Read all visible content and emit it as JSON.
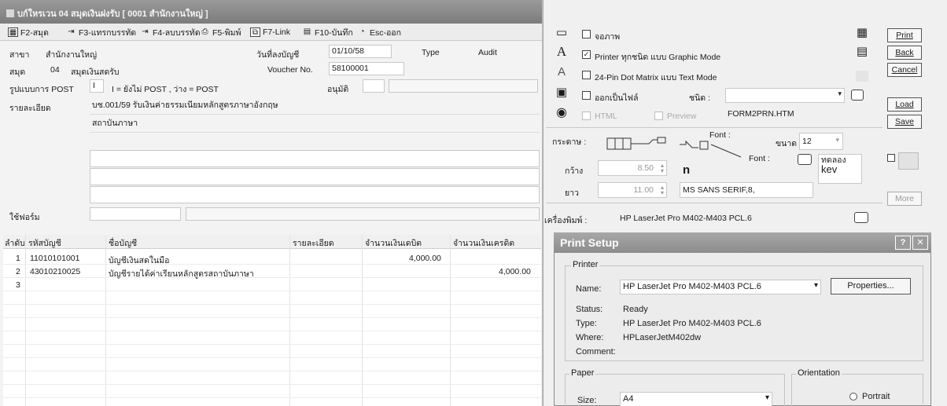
{
  "window": {
    "title": "บก์ใหรเวน 04 สมุดเงินฝงรับ [ 0001 สำนักงานใหญ่ ]"
  },
  "toolbar": {
    "f2": "F2-สมุด",
    "f3": "F3-แทรกบรรทัด",
    "f4": "F4-ลบบรรทัด",
    "f5": "F5-พิมพ์",
    "f7": "F7-Link",
    "f10": "F10-บันทึก",
    "esc": "Esc-ออก"
  },
  "form": {
    "branch_label": "สาขา",
    "branch_value": "สำนักงานใหญ่",
    "date_label": "วันที่ลงบัญชี",
    "date_value": "01/10/58",
    "type_label": "Type",
    "audit_label": "Audit",
    "book_label": "สมุด",
    "book_code": "04",
    "book_name": "สมุดเงินสดรับ",
    "voucher_label": "Voucher No.",
    "voucher_value": "58100001",
    "post_label": "รูปแบบการ POST",
    "post_value": "I",
    "post_hint": "I = ยังไม่ POST , ว่าง = POST",
    "approve_label": "อนุมัติ",
    "detail_label": "รายละเอียด",
    "detail_line1": "บช.001/59 รับเงินค่าธรรมเนียมหลักสูตรภาษาอังกฤษ",
    "detail_line2": "สถาบันภาษา",
    "form_label": "ใช้ฟอร์ม"
  },
  "grid": {
    "headers": {
      "seq": "ลำดับ",
      "acct_code": "รหัสบัญชี",
      "acct_name": "ชื่อบัญชี",
      "desc": "รายละเอียด",
      "debit": "จำนวนเงินเดบิต",
      "credit": "จำนวนเงินเครดิต"
    },
    "rows": [
      {
        "seq": "1",
        "code": "11010101001",
        "name": "บัญชีเงินสดในมือ",
        "debit": "4,000.00",
        "credit": ""
      },
      {
        "seq": "2",
        "code": "43010210025",
        "name": "บัญชีรายได้ค่าเรียนหลักสูตรสถาบันภาษา",
        "debit": "",
        "credit": "4,000.00"
      },
      {
        "seq": "3",
        "code": "",
        "name": "",
        "debit": "",
        "credit": ""
      }
    ]
  },
  "print_panel": {
    "opt_screen": "จอภาพ",
    "opt_graphic": "Printer ทุกชนิด แบบ Graphic Mode",
    "opt_graphic_checked": true,
    "opt_dotmatrix": "24-Pin Dot Matrix แบบ Text Mode",
    "opt_file": "ออกเป็นไฟล์",
    "file_type_label": "ชนิด :",
    "html_label": "HTML",
    "preview_label": "Preview",
    "filename": "FORM2PRN.HTM",
    "paper_label": "กระดาษ :",
    "width_label": "กว้าง",
    "width_value": "8.50",
    "length_label": "ยาว",
    "length_value": "11.00",
    "font_label1": "Font :",
    "font_label2": "Font :",
    "size_label": "ขนาด",
    "size_value": "12",
    "font_name": "MS SANS SERIF,8,",
    "test_label": "ทดลอง",
    "test_value": "kev",
    "printer_label": "เครื่องพิมพ์ :",
    "printer_name": "HP LaserJet Pro M402-M403 PCL.6",
    "buttons": {
      "print": "Print",
      "back": "Back",
      "cancel": "Cancel",
      "load": "Load",
      "save": "Save",
      "more": "More"
    }
  },
  "print_setup": {
    "title": "Print Setup",
    "help": "?",
    "close": "✕",
    "printer_group": "Printer",
    "name_label": "Name:",
    "name_value": "HP LaserJet Pro M402-M403 PCL.6",
    "properties": "Properties...",
    "status_label": "Status:",
    "status_value": "Ready",
    "type_label": "Type:",
    "type_value": "HP LaserJet Pro M402-M403 PCL.6",
    "where_label": "Where:",
    "where_value": "HPLaserJetM402dw",
    "comment_label": "Comment:",
    "paper_group": "Paper",
    "size_label": "Size:",
    "size_value": "A4",
    "orientation_group": "Orientation",
    "portrait": "Portrait"
  }
}
